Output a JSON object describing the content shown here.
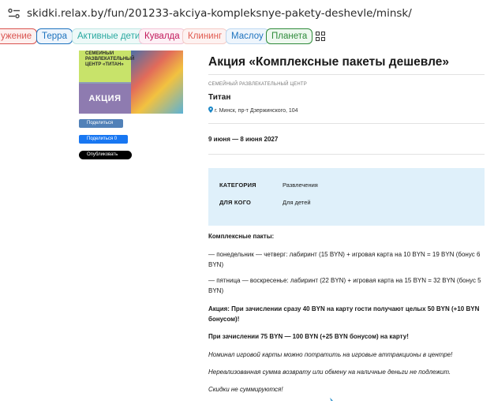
{
  "browser": {
    "url": "skidki.relax.by/fun/201233-akciya-kompleksnye-pakety-deshevle/minsk/"
  },
  "tags": [
    {
      "label": "ужение",
      "color": "#d9534f"
    },
    {
      "label": "Терра",
      "color": "#1e73be"
    },
    {
      "label": "Активные дети",
      "color": "#2aa9a0"
    },
    {
      "label": "Кувалда",
      "color": "#c2185b"
    },
    {
      "label": "Клининг",
      "color": "#e05a4f"
    },
    {
      "label": "Маслоу",
      "color": "#1e73be"
    },
    {
      "label": "Планета",
      "color": "#2e8b3a"
    }
  ],
  "promo": {
    "venue_text": "СЕМЕЙНЫЙ РАЗВЛЕКАТЕЛЬНЫЙ ЦЕНТР «ТИТАН»",
    "badge": "АКЦИЯ"
  },
  "share": {
    "vk": "Поделиться",
    "fb": "Поделиться 0",
    "x": "Опубликовать"
  },
  "article": {
    "title": "Акция «Комплексные пакеты дешевле»",
    "venue_category": "СЕМЕЙНЫЙ РАЗВЛЕКАТЕЛЬНЫЙ ЦЕНТР",
    "venue_name": "Титан",
    "venue_address": "г. Минск, пр-т Дзержинского, 104",
    "dates": "9 июня — 8 июня 2027",
    "info": {
      "category_label": "КАТЕГОРИЯ",
      "category_value": "Развлечения",
      "audience_label": "ДЛЯ КОГО",
      "audience_value": "Для детей"
    },
    "packages_heading": "Комплексные пакты:",
    "p1": "— понедельник — четверг: лабиринт (15 BYN) + игровая карта на 10 BYN = 19 BYN (бонус 6 BYN)",
    "p2": "— пятница — воскресенье: лабиринт (22 BYN) + игровая карта на 15 BYN = 32 BYN (бонус 5 BYN)",
    "p3": "Акция: При зачислении сразу 40 BYN на карту гости получают целых 50 BYN (+10 BYN бонусом)!",
    "p4": "При зачислении 75 BYN — 100 BYN (+25 BYN бонусом) на карту!",
    "p5": "Номинал игровой карты можно потратить на игровые аттракционы в центре!",
    "p6": "Нереализованная сумма возврату или обмену на наличные деньги не подлежит.",
    "p7": "Скидки не суммируются!"
  }
}
